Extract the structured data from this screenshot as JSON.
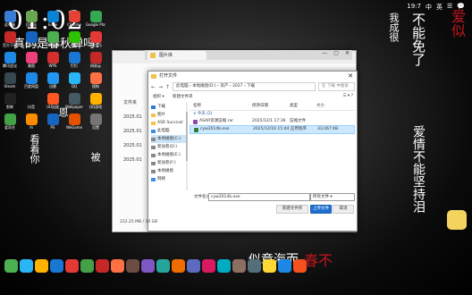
{
  "wallpaper": {
    "clock": "01:02",
    "phrase": "真的是春秋蝉吗?",
    "vertical_texts": [
      {
        "text": "不能免了",
        "color": "#ffffff"
      },
      {
        "text": "爱情不能坚持泪",
        "color": "#ffffff"
      },
      {
        "text": "我成很",
        "color": "#ffffff"
      },
      {
        "text": "爱似",
        "color": "#c0161c"
      },
      {
        "text": "似章海而",
        "color": "#ffffff"
      },
      {
        "text": "春不",
        "color": "#c0161c"
      },
      {
        "text": "看着你",
        "color": "#ffffff"
      },
      {
        "text": "恩",
        "color": "#ffffff"
      },
      {
        "text": "被",
        "color": "#ffffff"
      }
    ]
  },
  "system_tray": [
    "19:7",
    "中",
    "英",
    "☰",
    "💬"
  ],
  "desktop_icons": [
    {
      "label": "此电脑",
      "color": "#3a7bd5"
    },
    {
      "label": "回收站",
      "color": "#6aa84f"
    },
    {
      "label": "Edge",
      "color": "#0b84d8"
    },
    {
      "label": "Chrome",
      "color": "#e34234"
    },
    {
      "label": "Google Play",
      "color": "#34a853"
    },
    {
      "label": "官方下载",
      "color": "#c62828"
    },
    {
      "label": "ToDesk",
      "color": "#1565c0"
    },
    {
      "label": "360安全",
      "color": "#4caf50"
    },
    {
      "label": "微信",
      "color": "#2dc100"
    },
    {
      "label": "QQ音乐",
      "color": "#e53935"
    },
    {
      "label": "腾讯会议",
      "color": "#1e88e5"
    },
    {
      "label": "美图",
      "color": "#ec407a"
    },
    {
      "label": "WPS",
      "color": "#d32f2f"
    },
    {
      "label": "钉钉",
      "color": "#1976d2"
    },
    {
      "label": "网易云",
      "color": "#c62828"
    },
    {
      "label": "Steam",
      "color": "#37474f"
    },
    {
      "label": "百度网盘",
      "color": "#1e88e5"
    },
    {
      "label": "迅雷",
      "color": "#2196f3"
    },
    {
      "label": "QQ",
      "color": "#29b6f6"
    },
    {
      "label": "搜狗",
      "color": "#ff7043"
    },
    {
      "label": "剪映",
      "color": "#212121"
    },
    {
      "label": "抖音",
      "color": "#111111"
    },
    {
      "label": "UU加速",
      "color": "#ff5722"
    },
    {
      "label": "Wallpaper",
      "color": "#455a64"
    },
    {
      "label": "QQ游戏",
      "color": "#ffb300"
    },
    {
      "label": "爱奇艺",
      "color": "#43a047"
    },
    {
      "label": "Ai",
      "color": "#fb8c00"
    },
    {
      "label": "PS",
      "color": "#1565c0"
    },
    {
      "label": "WeGame",
      "color": "#e65100"
    },
    {
      "label": "设置",
      "color": "#757575"
    }
  ],
  "bg_window": {
    "tab_label": "图片库",
    "sidebar": [
      "文件夹",
      "2025.01",
      "2025.01",
      "2025.01",
      "2025.01"
    ]
  },
  "dialog": {
    "title": "打开文件",
    "close": "✕",
    "back": "←",
    "forward": "→",
    "up": "↑",
    "path": "此电脑 › 本地磁盘(D:) › 资产 › 2027 › 下载",
    "search_placeholder": "在 下载 中搜索",
    "organize": "组织 ▾",
    "new_folder": "新建文件夹",
    "view_icons": "☰ ▾ ?",
    "nav_items": [
      {
        "label": "下载",
        "sel": false,
        "color": "#2f7ad8"
      },
      {
        "label": "图片",
        "sel": false,
        "color": "#f0c34a"
      },
      {
        "label": "ASR Survival",
        "sel": false,
        "color": "#f0c34a"
      },
      {
        "label": "此电脑",
        "sel": false,
        "color": "#3a8ee6"
      },
      {
        "label": "本地磁盘(C:)",
        "sel": true,
        "color": "#888888"
      },
      {
        "label": "新加卷(D:)",
        "sel": false,
        "color": "#888888"
      },
      {
        "label": "本地磁盘(E:)",
        "sel": false,
        "color": "#888888"
      },
      {
        "label": "新加卷(F:)",
        "sel": false,
        "color": "#888888"
      },
      {
        "label": "本地磁盘",
        "sel": false,
        "color": "#888888"
      },
      {
        "label": "网络",
        "sel": false,
        "color": "#3a8ee6"
      }
    ],
    "columns": [
      "名称",
      "修改日期",
      "类型",
      "大小"
    ],
    "group_label": "∨ 今天 (2)",
    "files": [
      {
        "name": "ASAR资源压缩.rar",
        "date": "2025/12/1 17:36",
        "type": "压缩文件",
        "size": "",
        "icon": "#8e44ad",
        "sel": false
      },
      {
        "name": "cyw2014b.exe",
        "date": "2025/12/16 15:44",
        "type": "应用程序",
        "size": "33,067 KB",
        "icon": "#2e7d32",
        "sel": true
      }
    ],
    "filename_label": "文件名(N):",
    "filename_value": "cyw2014b.exe",
    "filetype_value": "所有文件 ▾",
    "btn_new_folder": "新建文件夹",
    "btn_open": "上传文件",
    "btn_cancel": "取消"
  },
  "status_text": "222.25 MB / 10 GB",
  "dock_colors": [
    "#4caf50",
    "#29b6f6",
    "#ffb300",
    "#1976d2",
    "#e53935",
    "#43a047",
    "#c62828",
    "#ff7043",
    "#6d4c41",
    "#7e57c2",
    "#26a69a",
    "#ef6c00",
    "#5c6bc0",
    "#d81b60",
    "#00acc1",
    "#8d6e63",
    "#546e7a",
    "#fdd835",
    "#1e88e5",
    "#f4511e"
  ]
}
